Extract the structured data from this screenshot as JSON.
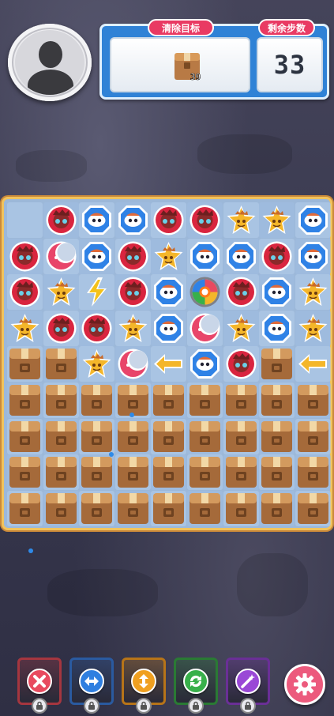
{
  "header": {
    "goal_label": "清除目标",
    "moves_label": "剩余步数",
    "moves_remaining": "33",
    "goal_item": {
      "icon": "cardboard-box-icon",
      "count": "39"
    }
  },
  "board": {
    "columns": 9,
    "rows": 9,
    "legend": {
      "R": "red-spiky-creature-piece",
      "B": "blue-hexagon-piece",
      "Y": "yellow-star-piece",
      "M": "pink-moon-piece",
      "L": "yellow-lightning-piece",
      "A": "left-arrow-rocket-piece",
      "S": "rainbow-bomb-piece",
      "C": "cardboard-box-blocker",
      "E": "empty-cell"
    },
    "grid": [
      [
        "E",
        "R",
        "B",
        "B",
        "R",
        "R",
        "Y",
        "Y",
        "B"
      ],
      [
        "R",
        "M",
        "B",
        "R",
        "Y",
        "B",
        "B",
        "R",
        "B"
      ],
      [
        "R",
        "Y",
        "L",
        "R",
        "B",
        "S",
        "R",
        "B",
        "Y"
      ],
      [
        "Y",
        "R",
        "R",
        "Y",
        "B",
        "M",
        "Y",
        "B",
        "Y"
      ],
      [
        "C",
        "C",
        "Y",
        "M",
        "A",
        "B",
        "R",
        "C",
        "A"
      ],
      [
        "C",
        "C",
        "C",
        "C",
        "C",
        "C",
        "C",
        "C",
        "C"
      ],
      [
        "C",
        "C",
        "C",
        "C",
        "C",
        "C",
        "C",
        "C",
        "C"
      ],
      [
        "C",
        "C",
        "C",
        "C",
        "C",
        "C",
        "C",
        "C",
        "C"
      ],
      [
        "C",
        "C",
        "C",
        "C",
        "C",
        "C",
        "C",
        "C",
        "C"
      ]
    ]
  },
  "boosters": [
    {
      "icon": "hammer-cross-icon",
      "color": "#e84a5f",
      "frame": "#a5363f",
      "locked": true
    },
    {
      "icon": "horizontal-swap-icon",
      "color": "#2f7fe0",
      "frame": "#2a5aa0",
      "locked": true
    },
    {
      "icon": "vertical-swap-icon",
      "color": "#f0a020",
      "frame": "#b77418",
      "locked": true
    },
    {
      "icon": "shuffle-refresh-icon",
      "color": "#38b04a",
      "frame": "#2a7a34",
      "locked": true
    },
    {
      "icon": "magic-wand-icon",
      "color": "#9a48d6",
      "frame": "#6a2f96",
      "locked": true
    }
  ],
  "settings": {
    "icon": "gear-icon"
  },
  "colors": {
    "accent": "#e93a63",
    "panel": "#2f82d6",
    "board_border": "#f1c35d"
  }
}
